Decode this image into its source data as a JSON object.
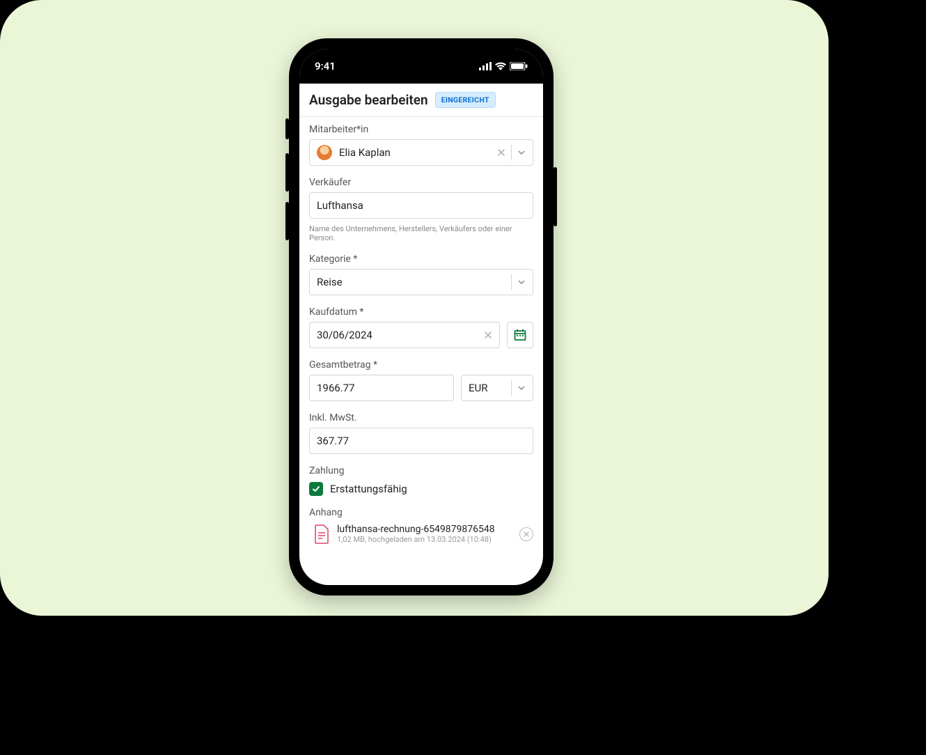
{
  "statusbar": {
    "time": "9:41"
  },
  "header": {
    "title": "Ausgabe bearbeiten",
    "status_badge": "EINGEREICHT"
  },
  "form": {
    "employee": {
      "label": "Mitarbeiter*in",
      "value": "Elia Kaplan"
    },
    "vendor": {
      "label": "Verkäufer",
      "value": "Lufthansa",
      "hint": "Name des Unternehmens, Herstellers, Verkäufers oder einer Person."
    },
    "category": {
      "label": "Kategorie",
      "value": "Reise"
    },
    "purchase_date": {
      "label": "Kaufdatum",
      "value": "30/06/2024"
    },
    "total": {
      "label": "Gesamtbetrag",
      "amount": "1966.77",
      "currency": "EUR"
    },
    "vat": {
      "label": "Inkl. MwSt.",
      "value": "367.77"
    },
    "payment": {
      "label": "Zahlung",
      "checkbox_label": "Erstattungsfähig",
      "checked": true
    },
    "attachment": {
      "label": "Anhang",
      "file_name": "lufthansa-rechnung-6549879876548",
      "file_meta": "1,02 MB, hochgeladen am 13.03.2024 (10:48)"
    }
  }
}
